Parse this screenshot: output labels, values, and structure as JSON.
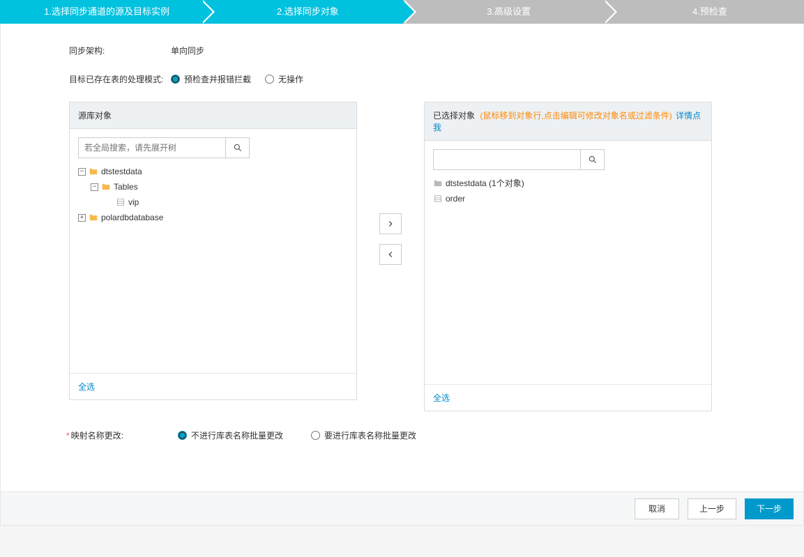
{
  "stepper": {
    "step1": "1.选择同步通道的源及目标实例",
    "step2": "2.选择同步对象",
    "step3": "3.高级设置",
    "step4": "4.预检查"
  },
  "sync_arch": {
    "label": "同步架构:",
    "value": "单向同步"
  },
  "target_mode": {
    "label": "目标已存在表的处理模式:",
    "option1": "预检查并报错拦截",
    "option2": "无操作"
  },
  "source_panel": {
    "title": "源库对象",
    "search_placeholder": "若全局搜索，请先展开树",
    "select_all": "全选",
    "tree": {
      "db1": "dtstestdata",
      "tables_label": "Tables",
      "table_vip": "vip",
      "db2": "polardbdatabase"
    }
  },
  "selected_panel": {
    "title": "已选择对象",
    "hint": "(鼠标移到对象行,点击编辑可修改对象名或过滤条件)",
    "hint_link": "详情点我",
    "select_all": "全选",
    "items": {
      "db": "dtstestdata (1个对象)",
      "table": "order"
    }
  },
  "mapping": {
    "label": "映射名称更改:",
    "option1": "不进行库表名称批量更改",
    "option2": "要进行库表名称批量更改"
  },
  "buttons": {
    "cancel": "取消",
    "prev": "上一步",
    "next": "下一步"
  }
}
